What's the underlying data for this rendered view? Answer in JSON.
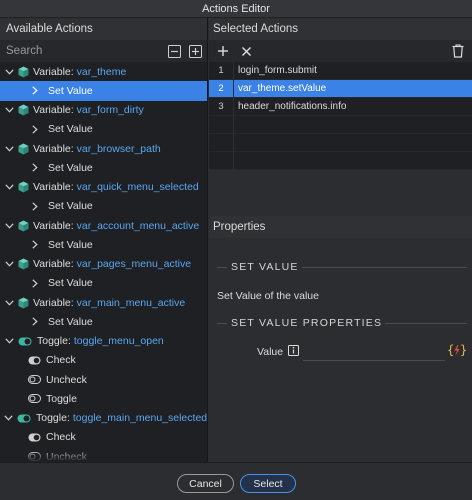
{
  "window": {
    "title": "Actions Editor"
  },
  "left_panel": {
    "title": "Available Actions",
    "search_placeholder": "Search",
    "tree": [
      {
        "kind": "variable",
        "prefix": "Variable:",
        "name": "var_theme",
        "children": [
          {
            "label": "Set Value",
            "selected": true
          }
        ]
      },
      {
        "kind": "variable",
        "prefix": "Variable:",
        "name": "var_form_dirty",
        "children": [
          {
            "label": "Set Value"
          }
        ]
      },
      {
        "kind": "variable",
        "prefix": "Variable:",
        "name": "var_browser_path",
        "children": [
          {
            "label": "Set Value"
          }
        ]
      },
      {
        "kind": "variable",
        "prefix": "Variable:",
        "name": "var_quick_menu_selected",
        "children": [
          {
            "label": "Set Value"
          }
        ]
      },
      {
        "kind": "variable",
        "prefix": "Variable:",
        "name": "var_account_menu_active",
        "children": [
          {
            "label": "Set Value"
          }
        ]
      },
      {
        "kind": "variable",
        "prefix": "Variable:",
        "name": "var_pages_menu_active",
        "children": [
          {
            "label": "Set Value"
          }
        ]
      },
      {
        "kind": "variable",
        "prefix": "Variable:",
        "name": "var_main_menu_active",
        "children": [
          {
            "label": "Set Value"
          }
        ]
      },
      {
        "kind": "toggle",
        "prefix": "Toggle:",
        "name": "toggle_menu_open",
        "children": [
          {
            "label": "Check",
            "icon": "on"
          },
          {
            "label": "Uncheck",
            "icon": "off"
          },
          {
            "label": "Toggle",
            "icon": "off"
          }
        ]
      },
      {
        "kind": "toggle",
        "prefix": "Toggle:",
        "name": "toggle_main_menu_selected",
        "children": [
          {
            "label": "Check",
            "icon": "on"
          },
          {
            "label": "Uncheck",
            "icon": "off"
          }
        ]
      }
    ]
  },
  "right_panel": {
    "title": "Selected Actions",
    "selected_actions": [
      {
        "num": "1",
        "label": "login_form.submit",
        "selected": false
      },
      {
        "num": "2",
        "label": "var_theme.setValue",
        "selected": true
      },
      {
        "num": "3",
        "label": "header_notifications.info",
        "selected": false
      }
    ],
    "properties": {
      "title": "Properties",
      "section1_title": "SET VALUE",
      "description": "Set Value of the value",
      "section2_title": "SET VALUE PROPERTIES",
      "value_label": "Value",
      "value": ""
    }
  },
  "footer": {
    "cancel_label": "Cancel",
    "select_label": "Select"
  },
  "colors": {
    "accent": "#3b82e6",
    "var_name": "#5aa7f0",
    "cube": "#4fb6a4",
    "expr_brace": "#e8b64a",
    "expr_bolt": "#e0503a"
  }
}
